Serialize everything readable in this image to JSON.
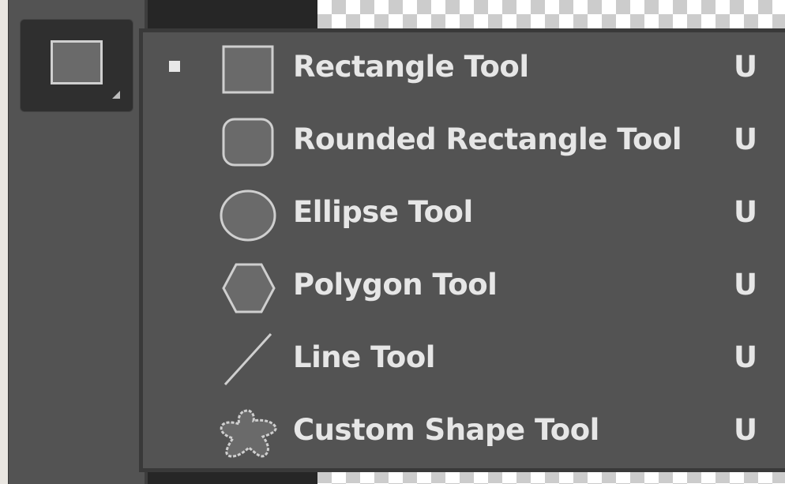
{
  "toolbar": {
    "active_tool_icon": "rectangle-icon",
    "has_flyout_indicator": true
  },
  "flyout": {
    "items": [
      {
        "label": "Rectangle Tool",
        "shortcut": "U",
        "icon": "rectangle-icon",
        "selected": true
      },
      {
        "label": "Rounded Rectangle Tool",
        "shortcut": "U",
        "icon": "rounded-rectangle-icon",
        "selected": false
      },
      {
        "label": "Ellipse Tool",
        "shortcut": "U",
        "icon": "ellipse-icon",
        "selected": false
      },
      {
        "label": "Polygon Tool",
        "shortcut": "U",
        "icon": "polygon-icon",
        "selected": false
      },
      {
        "label": "Line Tool",
        "shortcut": "U",
        "icon": "line-icon",
        "selected": false
      },
      {
        "label": "Custom Shape Tool",
        "shortcut": "U",
        "icon": "custom-shape-icon",
        "selected": false
      }
    ]
  },
  "colors": {
    "panel_bg": "#535353",
    "border": "#393939",
    "text": "#e6e6e6",
    "icon_fill": "#6a6a6a",
    "icon_stroke": "#cfcfcf"
  }
}
